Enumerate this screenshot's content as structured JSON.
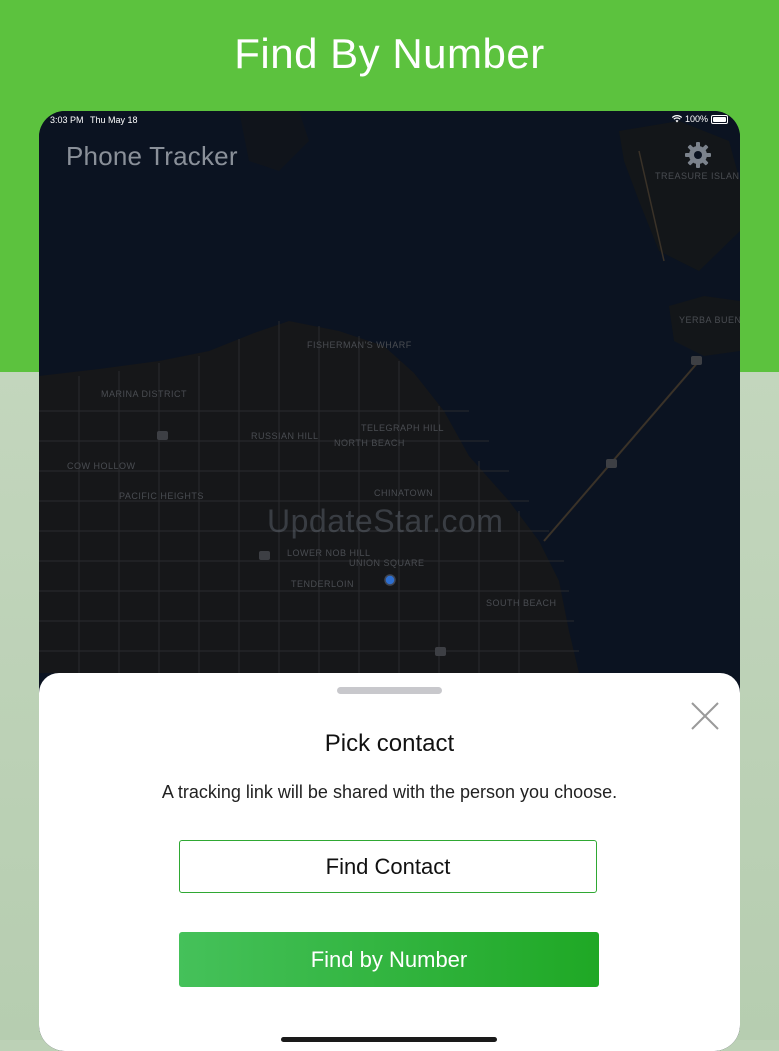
{
  "banner": {
    "headline": "Find By Number",
    "colors": {
      "green": "#5cc23e",
      "sage": "#bcd1b6"
    }
  },
  "status_bar": {
    "time": "3:03 PM",
    "date": "Thu May 18",
    "battery": "100%",
    "wifi_icon": "wifi-icon",
    "battery_icon": "battery-icon"
  },
  "app": {
    "title": "Phone Tracker",
    "settings_icon": "gear-icon"
  },
  "map": {
    "watermark": "UpdateStar.com",
    "labels": [
      "FISHERMAN'S WHARF",
      "MARINA DISTRICT",
      "TELEGRAPH HILL",
      "RUSSIAN HILL",
      "NORTH BEACH",
      "COW HOLLOW",
      "PACIFIC HEIGHTS",
      "CHINATOWN",
      "LOWER NOB HILL",
      "UNION SQUARE",
      "TENDERLOIN",
      "SOUTH BEACH",
      "TREASURE ISLAND",
      "YERBA BUENA ISLAND"
    ],
    "location_dot_icon": "current-location-icon"
  },
  "sheet": {
    "title": "Pick contact",
    "subtitle": "A tracking link will be shared with the person you choose.",
    "find_contact_label": "Find Contact",
    "find_by_number_label": "Find by Number",
    "close_icon": "close-icon",
    "accent": "#2fa833"
  }
}
